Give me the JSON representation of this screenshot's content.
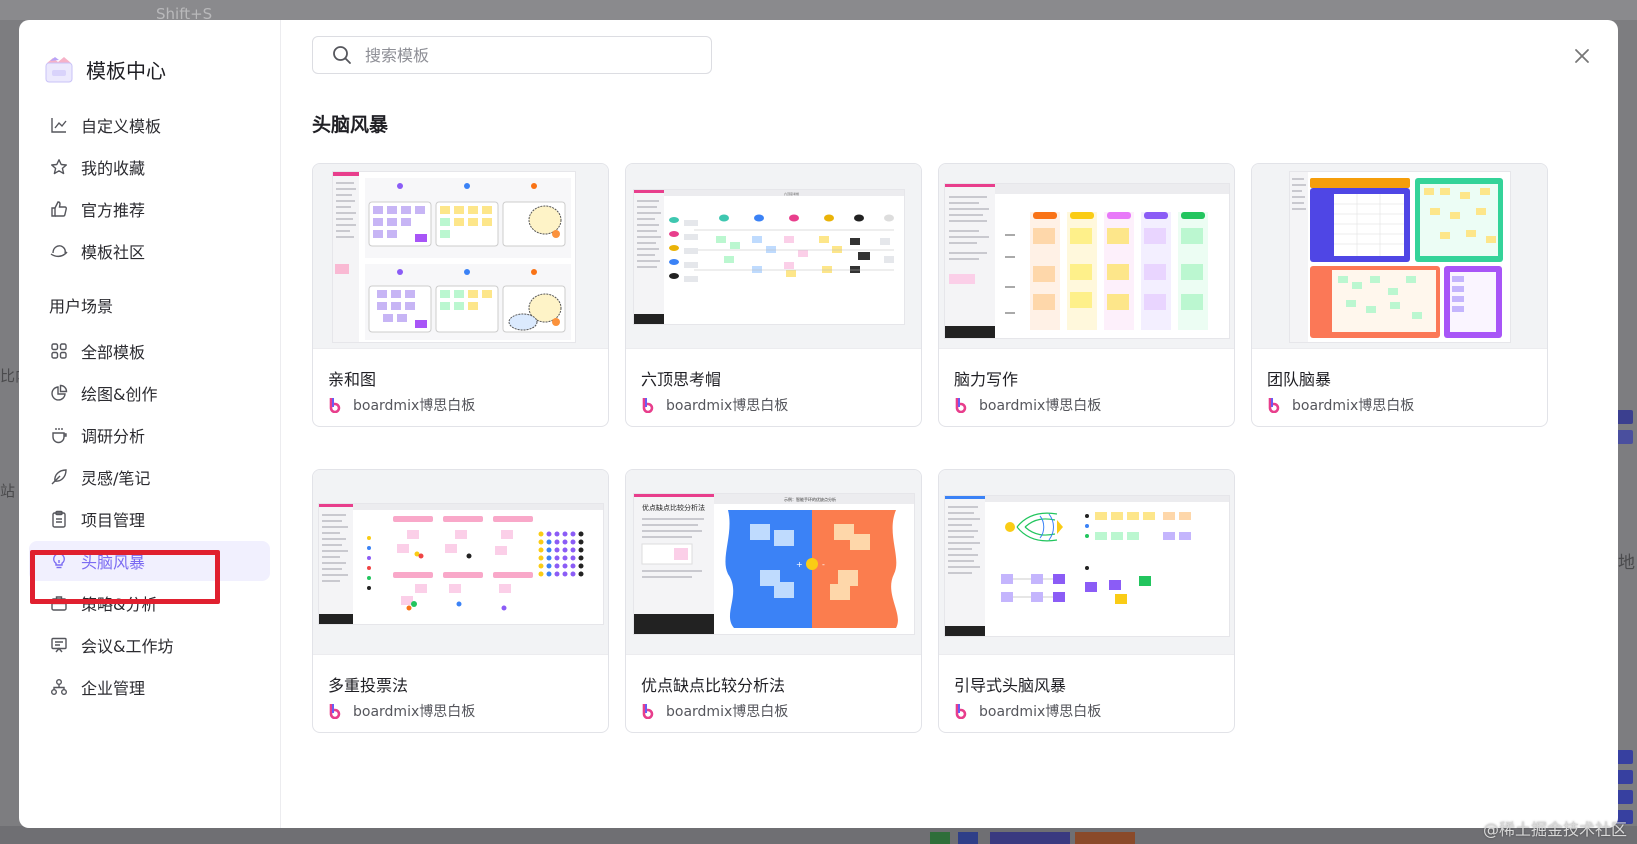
{
  "background": {
    "shortcut_hint": "Shift+S",
    "left_fragment_1": "比内",
    "left_fragment_2": "站",
    "right_fragment": "地"
  },
  "sidebar": {
    "brand_title": "模板中心",
    "top_items": [
      {
        "label": "自定义模板",
        "icon": "chart-edit-icon"
      },
      {
        "label": "我的收藏",
        "icon": "star-icon"
      },
      {
        "label": "官方推荐",
        "icon": "thumbs-up-icon"
      },
      {
        "label": "模板社区",
        "icon": "community-icon"
      }
    ],
    "section_title": "用户场景",
    "scene_items": [
      {
        "label": "全部模板",
        "icon": "grid-icon"
      },
      {
        "label": "绘图&创作",
        "icon": "pie-chart-icon"
      },
      {
        "label": "调研分析",
        "icon": "research-icon"
      },
      {
        "label": "灵感/笔记",
        "icon": "feather-icon"
      },
      {
        "label": "项目管理",
        "icon": "clipboard-icon"
      },
      {
        "label": "头脑风暴",
        "icon": "lightbulb-icon",
        "active": true
      },
      {
        "label": "策略&分析",
        "icon": "briefcase-icon"
      },
      {
        "label": "会议&工作坊",
        "icon": "presentation-icon"
      },
      {
        "label": "企业管理",
        "icon": "org-chart-icon"
      }
    ]
  },
  "main": {
    "search_placeholder": "搜索模板",
    "section_heading": "头脑风暴",
    "cards": [
      {
        "title": "亲和图",
        "author": "boardmix博思白板"
      },
      {
        "title": "六顶思考帽",
        "author": "boardmix博思白板"
      },
      {
        "title": "脑力写作",
        "author": "boardmix博思白板"
      },
      {
        "title": "团队脑暴",
        "author": "boardmix博思白板"
      },
      {
        "title": "多重投票法",
        "author": "boardmix博思白板"
      },
      {
        "title": "优点缺点比较分析法",
        "author": "boardmix博思白板"
      },
      {
        "title": "引导式头脑风暴",
        "author": "boardmix博思白板"
      }
    ]
  },
  "thumbnails": {
    "six_hats_label": "六顶思考帽",
    "procon_heading": "优点缺点比较分析法",
    "procon_banner": "示例：智能手环的优缺点分析"
  },
  "watermark": "@稀土掘金技术社区",
  "colors": {
    "accent": "#7c6cf2",
    "active_bg": "#f1f0fe",
    "highlight_border": "#e0202f",
    "brand_pink": "#e83e8c"
  }
}
